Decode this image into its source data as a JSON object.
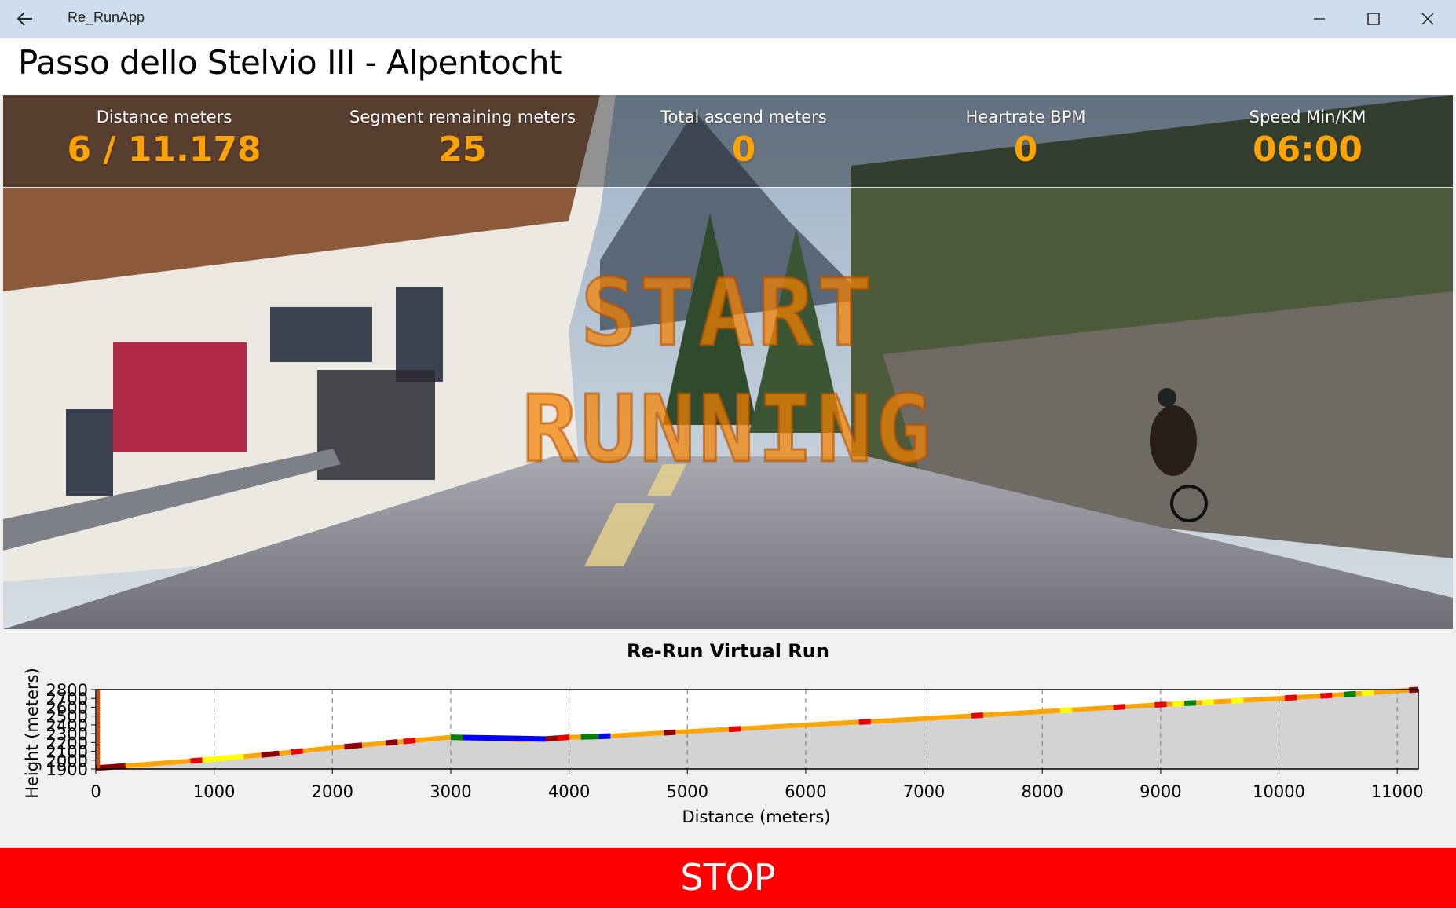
{
  "window": {
    "app_title": "Re_RunApp",
    "back_icon": "back-arrow-icon",
    "minimize_icon": "minimize-icon",
    "maximize_icon": "maximize-icon",
    "close_icon": "close-icon"
  },
  "page": {
    "title": "Passo dello Stelvio III - Alpentocht"
  },
  "stats": [
    {
      "label": "Distance meters",
      "value": "6 / 11.178"
    },
    {
      "label": "Segment remaining meters",
      "value": "25"
    },
    {
      "label": "Total ascend meters",
      "value": "0"
    },
    {
      "label": "Heartrate BPM",
      "value": "0"
    },
    {
      "label": "Speed Min/KM",
      "value": "06:00"
    }
  ],
  "overlay": {
    "line1": "START",
    "line2": "RUNNING"
  },
  "stop_button": {
    "label": "STOP"
  },
  "colors": {
    "accent": "#ffa300",
    "stop": "#ff0000",
    "profile_line": "#ffa500",
    "segment_red": "#e80000",
    "segment_darkred": "#8b0000",
    "segment_yellow": "#ffff00",
    "segment_green": "#008000",
    "segment_blue": "#0000ff",
    "fill": "#d3d3d3"
  },
  "chart_data": {
    "type": "area",
    "title": "Re-Run Virtual Run",
    "xlabel": "Distance (meters)",
    "ylabel": "Height (meters)",
    "xlim": [
      0,
      11178
    ],
    "ylim": [
      1900,
      2800
    ],
    "xticks": [
      0,
      1000,
      2000,
      3000,
      4000,
      5000,
      6000,
      7000,
      8000,
      9000,
      10000,
      11000
    ],
    "yticks": [
      1900,
      2000,
      2100,
      2200,
      2300,
      2400,
      2500,
      2600,
      2700,
      2800
    ],
    "grid": "vertical dashed",
    "series": [
      {
        "x": [
          0,
          500,
          1000,
          1500,
          2000,
          2500,
          3000,
          3300,
          3600,
          3800,
          4000,
          4300,
          4800,
          5500,
          6000,
          7000,
          8000,
          9000,
          10000,
          10500,
          11178
        ],
        "values": [
          1910,
          1960,
          2010,
          2070,
          2140,
          2200,
          2260,
          2250,
          2230,
          2240,
          2260,
          2270,
          2310,
          2360,
          2400,
          2470,
          2550,
          2630,
          2700,
          2740,
          2800
        ]
      }
    ],
    "segments": [
      {
        "x0": 0,
        "x1": 250,
        "color": "darkred"
      },
      {
        "x0": 800,
        "x1": 900,
        "color": "red"
      },
      {
        "x0": 900,
        "x1": 1250,
        "color": "yellow"
      },
      {
        "x0": 1400,
        "x1": 1550,
        "color": "darkred"
      },
      {
        "x0": 1650,
        "x1": 1750,
        "color": "red"
      },
      {
        "x0": 2100,
        "x1": 2250,
        "color": "darkred"
      },
      {
        "x0": 2450,
        "x1": 2550,
        "color": "darkred"
      },
      {
        "x0": 2600,
        "x1": 2700,
        "color": "red"
      },
      {
        "x0": 3000,
        "x1": 3100,
        "color": "green"
      },
      {
        "x0": 3100,
        "x1": 3800,
        "color": "blue"
      },
      {
        "x0": 3800,
        "x1": 3900,
        "color": "darkred"
      },
      {
        "x0": 3900,
        "x1": 4000,
        "color": "red"
      },
      {
        "x0": 4100,
        "x1": 4250,
        "color": "green"
      },
      {
        "x0": 4250,
        "x1": 4350,
        "color": "blue"
      },
      {
        "x0": 4800,
        "x1": 4900,
        "color": "darkred"
      },
      {
        "x0": 5350,
        "x1": 5450,
        "color": "red"
      },
      {
        "x0": 6450,
        "x1": 6550,
        "color": "red"
      },
      {
        "x0": 7400,
        "x1": 7500,
        "color": "red"
      },
      {
        "x0": 8150,
        "x1": 8250,
        "color": "yellow"
      },
      {
        "x0": 8600,
        "x1": 8700,
        "color": "red"
      },
      {
        "x0": 8950,
        "x1": 9050,
        "color": "red"
      },
      {
        "x0": 9100,
        "x1": 9200,
        "color": "yellow"
      },
      {
        "x0": 9200,
        "x1": 9300,
        "color": "green"
      },
      {
        "x0": 9350,
        "x1": 9450,
        "color": "yellow"
      },
      {
        "x0": 9600,
        "x1": 9700,
        "color": "yellow"
      },
      {
        "x0": 10050,
        "x1": 10150,
        "color": "red"
      },
      {
        "x0": 10350,
        "x1": 10450,
        "color": "red"
      },
      {
        "x0": 10550,
        "x1": 10650,
        "color": "green"
      },
      {
        "x0": 10700,
        "x1": 10800,
        "color": "yellow"
      },
      {
        "x0": 11100,
        "x1": 11178,
        "color": "darkred"
      }
    ]
  }
}
